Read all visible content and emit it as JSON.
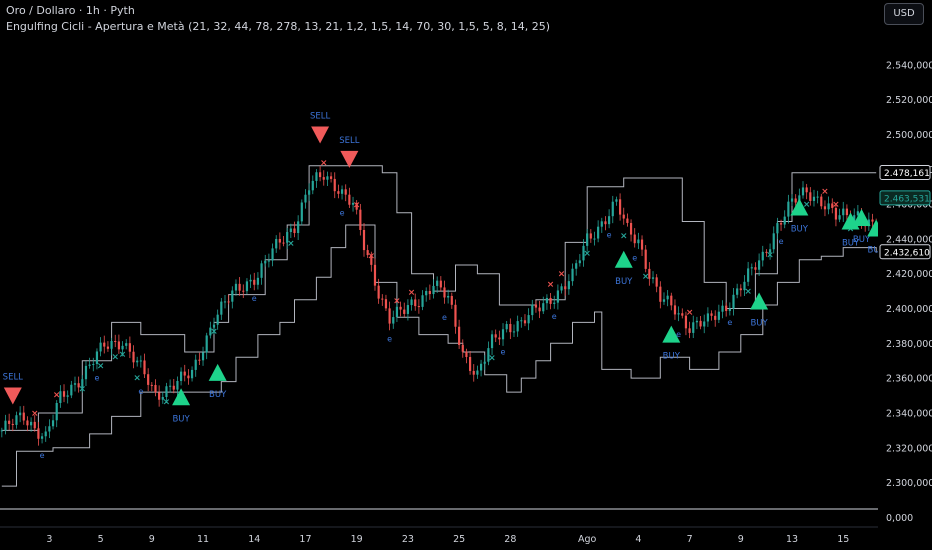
{
  "header": {
    "title": "Oro / Dollaro · 1h · Pyth",
    "indicator": "Engulfing Cicli - Apertura e Metà (21, 32, 44, 78, 278, 13, 21, 1,2, 1,5, 14, 70, 30, 1,5, 5, 8, 14, 25)",
    "currency_button": "USD"
  },
  "colors": {
    "background": "#000000",
    "bull": "#26a69a",
    "bear": "#ef5350",
    "channel": "#b2b5be",
    "buy_marker": "#1ed38b",
    "sell_marker": "#f05a5a",
    "label": "#3c74d8"
  },
  "chart_data": {
    "type": "candlestick",
    "title": "Oro / Dollaro · 1h · Pyth",
    "ylim": [
      2290,
      2560
    ],
    "y_ticks": [
      2300,
      2320,
      2340,
      2360,
      2380,
      2400,
      2420,
      2440,
      2460,
      2480,
      2500,
      2520,
      2540
    ],
    "y_tick_labels": [
      "2.300,000",
      "2.320,000",
      "2.340,000",
      "2.360,000",
      "2.380,000",
      "2.400,000",
      "2.420,000",
      "2.440,000",
      "2.460,000",
      "2.480,000",
      "2.500,000",
      "2.520,000",
      "2.540,000"
    ],
    "volume_axis_label": "0,000",
    "x_tick_labels": [
      "3",
      "5",
      "9",
      "11",
      "14",
      "17",
      "19",
      "23",
      "25",
      "28",
      "Ago",
      "4",
      "7",
      "9",
      "13",
      "15"
    ],
    "x_tick_index": [
      13,
      27,
      41,
      55,
      69,
      83,
      97,
      111,
      125,
      139,
      160,
      174,
      188,
      202,
      216,
      230
    ],
    "n_bars": 240,
    "price_path": [
      [
        0,
        2330
      ],
      [
        6,
        2338
      ],
      [
        12,
        2326
      ],
      [
        16,
        2348
      ],
      [
        22,
        2362
      ],
      [
        28,
        2378
      ],
      [
        33,
        2382
      ],
      [
        38,
        2365
      ],
      [
        42,
        2350
      ],
      [
        46,
        2356
      ],
      [
        52,
        2362
      ],
      [
        58,
        2395
      ],
      [
        64,
        2410
      ],
      [
        70,
        2420
      ],
      [
        76,
        2438
      ],
      [
        80,
        2448
      ],
      [
        84,
        2470
      ],
      [
        88,
        2476
      ],
      [
        92,
        2470
      ],
      [
        96,
        2460
      ],
      [
        99,
        2435
      ],
      [
        103,
        2410
      ],
      [
        106,
        2395
      ],
      [
        110,
        2398
      ],
      [
        114,
        2405
      ],
      [
        118,
        2415
      ],
      [
        122,
        2405
      ],
      [
        126,
        2375
      ],
      [
        130,
        2362
      ],
      [
        134,
        2380
      ],
      [
        138,
        2390
      ],
      [
        142,
        2392
      ],
      [
        148,
        2402
      ],
      [
        152,
        2410
      ],
      [
        156,
        2418
      ],
      [
        160,
        2440
      ],
      [
        165,
        2452
      ],
      [
        168,
        2460
      ],
      [
        171,
        2445
      ],
      [
        174,
        2440
      ],
      [
        177,
        2420
      ],
      [
        180,
        2405
      ],
      [
        184,
        2400
      ],
      [
        188,
        2390
      ],
      [
        193,
        2392
      ],
      [
        198,
        2402
      ],
      [
        204,
        2418
      ],
      [
        208,
        2430
      ],
      [
        212,
        2448
      ],
      [
        216,
        2460
      ],
      [
        220,
        2468
      ],
      [
        224,
        2462
      ],
      [
        228,
        2452
      ],
      [
        234,
        2455
      ],
      [
        239,
        2445
      ]
    ],
    "channel_upper": [
      [
        0,
        2330
      ],
      [
        10,
        2340
      ],
      [
        22,
        2370
      ],
      [
        30,
        2392
      ],
      [
        38,
        2385
      ],
      [
        50,
        2375
      ],
      [
        58,
        2392
      ],
      [
        62,
        2408
      ],
      [
        72,
        2428
      ],
      [
        78,
        2448
      ],
      [
        84,
        2482
      ],
      [
        100,
        2482
      ],
      [
        104,
        2478
      ],
      [
        108,
        2455
      ],
      [
        112,
        2420
      ],
      [
        118,
        2410
      ],
      [
        124,
        2425
      ],
      [
        130,
        2420
      ],
      [
        136,
        2402
      ],
      [
        146,
        2405
      ],
      [
        154,
        2438
      ],
      [
        160,
        2470
      ],
      [
        170,
        2475
      ],
      [
        176,
        2475
      ],
      [
        182,
        2475
      ],
      [
        186,
        2450
      ],
      [
        192,
        2415
      ],
      [
        198,
        2400
      ],
      [
        206,
        2420
      ],
      [
        212,
        2450
      ],
      [
        216,
        2478
      ],
      [
        226,
        2478
      ],
      [
        239,
        2478
      ]
    ],
    "channel_lower": [
      [
        0,
        2298
      ],
      [
        4,
        2318
      ],
      [
        14,
        2320
      ],
      [
        24,
        2328
      ],
      [
        30,
        2338
      ],
      [
        38,
        2352
      ],
      [
        50,
        2352
      ],
      [
        60,
        2358
      ],
      [
        64,
        2372
      ],
      [
        70,
        2385
      ],
      [
        76,
        2392
      ],
      [
        80,
        2405
      ],
      [
        86,
        2418
      ],
      [
        90,
        2435
      ],
      [
        94,
        2448
      ],
      [
        98,
        2448
      ],
      [
        102,
        2415
      ],
      [
        108,
        2395
      ],
      [
        114,
        2385
      ],
      [
        122,
        2380
      ],
      [
        126,
        2375
      ],
      [
        132,
        2362
      ],
      [
        138,
        2352
      ],
      [
        142,
        2360
      ],
      [
        146,
        2370
      ],
      [
        150,
        2380
      ],
      [
        156,
        2392
      ],
      [
        162,
        2398
      ],
      [
        164,
        2365
      ],
      [
        172,
        2360
      ],
      [
        180,
        2372
      ],
      [
        188,
        2365
      ],
      [
        196,
        2375
      ],
      [
        202,
        2385
      ],
      [
        208,
        2402
      ],
      [
        212,
        2415
      ],
      [
        218,
        2428
      ],
      [
        224,
        2430
      ],
      [
        230,
        2435
      ],
      [
        239,
        2432
      ]
    ],
    "price_labels": [
      {
        "value": 2478.161,
        "text": "2.478,161",
        "style": "white"
      },
      {
        "value": 2463.531,
        "text": "2.463,531",
        "style": "green"
      },
      {
        "value": 2432.61,
        "text": "2.432,610",
        "style": "white"
      }
    ],
    "signals": [
      {
        "i": 3,
        "type": "SELL",
        "price": 2350,
        "label": "SELL"
      },
      {
        "i": 49,
        "type": "BUY",
        "price": 2349,
        "label": "BUY"
      },
      {
        "i": 59,
        "type": "BUY",
        "price": 2363,
        "label": "BUY"
      },
      {
        "i": 87,
        "type": "SELL",
        "price": 2500,
        "label": "SELL"
      },
      {
        "i": 95,
        "type": "SELL",
        "price": 2486,
        "label": "SELL"
      },
      {
        "i": 170,
        "type": "BUY",
        "price": 2428,
        "label": "BUY"
      },
      {
        "i": 183,
        "type": "BUY",
        "price": 2385,
        "label": "BUY"
      },
      {
        "i": 207,
        "type": "BUY",
        "price": 2404,
        "label": "BUY"
      },
      {
        "i": 218,
        "type": "BUY",
        "price": 2458,
        "label": "BUY"
      },
      {
        "i": 232,
        "type": "BUY",
        "price": 2450,
        "label": "BUY"
      },
      {
        "i": 235,
        "type": "BUY",
        "price": 2452,
        "label": "BUY"
      },
      {
        "i": 239,
        "type": "BUY",
        "price": 2446,
        "label": "BUY"
      }
    ],
    "marks": [
      {
        "i": 9,
        "kind": "x-bear"
      },
      {
        "i": 15,
        "kind": "x-bear"
      },
      {
        "i": 22,
        "kind": "x-bull"
      },
      {
        "i": 27,
        "kind": "x-bull"
      },
      {
        "i": 31,
        "kind": "x-bull"
      },
      {
        "i": 33,
        "kind": "x-bull"
      },
      {
        "i": 37,
        "kind": "x-bull"
      },
      {
        "i": 45,
        "kind": "x-bull"
      },
      {
        "i": 49,
        "kind": "x-bull"
      },
      {
        "i": 58,
        "kind": "x-bull"
      },
      {
        "i": 79,
        "kind": "x-bull"
      },
      {
        "i": 88,
        "kind": "x-bear"
      },
      {
        "i": 97,
        "kind": "x-bear"
      },
      {
        "i": 101,
        "kind": "x-bear"
      },
      {
        "i": 108,
        "kind": "x-bear"
      },
      {
        "i": 112,
        "kind": "x-bear"
      },
      {
        "i": 134,
        "kind": "x-bull"
      },
      {
        "i": 150,
        "kind": "x-bear"
      },
      {
        "i": 153,
        "kind": "x-bear"
      },
      {
        "i": 160,
        "kind": "x-bull"
      },
      {
        "i": 170,
        "kind": "x-bull"
      },
      {
        "i": 176,
        "kind": "x-bull"
      },
      {
        "i": 188,
        "kind": "x-bear"
      },
      {
        "i": 204,
        "kind": "x-bull"
      },
      {
        "i": 210,
        "kind": "x-bull"
      },
      {
        "i": 220,
        "kind": "x-bull"
      },
      {
        "i": 225,
        "kind": "x-bear"
      },
      {
        "i": 228,
        "kind": "x-bear"
      },
      {
        "i": 232,
        "kind": "x-bull"
      },
      {
        "i": 11,
        "kind": "e"
      },
      {
        "i": 26,
        "kind": "e"
      },
      {
        "i": 38,
        "kind": "e"
      },
      {
        "i": 69,
        "kind": "e"
      },
      {
        "i": 93,
        "kind": "e"
      },
      {
        "i": 106,
        "kind": "e"
      },
      {
        "i": 121,
        "kind": "e"
      },
      {
        "i": 137,
        "kind": "e"
      },
      {
        "i": 151,
        "kind": "e"
      },
      {
        "i": 166,
        "kind": "e"
      },
      {
        "i": 173,
        "kind": "e"
      },
      {
        "i": 185,
        "kind": "e"
      },
      {
        "i": 199,
        "kind": "e"
      },
      {
        "i": 213,
        "kind": "e"
      }
    ]
  }
}
